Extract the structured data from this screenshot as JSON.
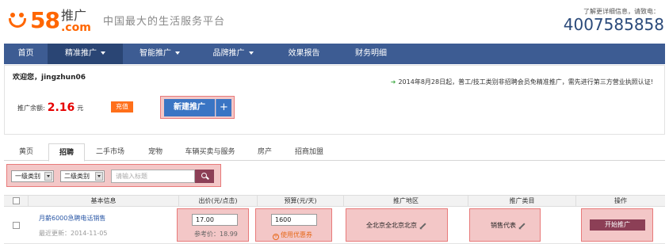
{
  "header": {
    "logo_number": "58",
    "logo_tg": "推广",
    "logo_com": ".com",
    "slogan": "中国最大的生活服务平台",
    "hotline_label": "了解更详细信息，请致电：",
    "hotline": "4007585858"
  },
  "nav": {
    "items": [
      {
        "label": "首页",
        "dropdown": false
      },
      {
        "label": "精准推广",
        "dropdown": true,
        "active": true
      },
      {
        "label": "智能推广",
        "dropdown": true
      },
      {
        "label": "品牌推广",
        "dropdown": true
      },
      {
        "label": "效果报告",
        "dropdown": false
      },
      {
        "label": "财务明细",
        "dropdown": false
      }
    ]
  },
  "account": {
    "welcome": "欢迎您，jingzhun06",
    "notice": "2014年8月28日起，普工/技工类别非招聘会员免精准推广，需先进行第三方营业执照认证!",
    "balance_label": "推广余额:",
    "balance": "2.16",
    "balance_unit": "元",
    "recharge_label": "充值",
    "new_promo_label": "新建推广",
    "plus_label": "+"
  },
  "tabs": [
    "黄页",
    "招聘",
    "二手市场",
    "宠物",
    "车辆买卖与服务",
    "房产",
    "招商加盟"
  ],
  "active_tab": "招聘",
  "filter": {
    "category1": "一级类别",
    "category2": "二级类别",
    "title_placeholder": "请输入标题"
  },
  "table": {
    "headers": [
      "基本信息",
      "出价(元/点击)",
      "预算(元/天)",
      "推广地区",
      "推广类目",
      "操作"
    ],
    "rows": [
      {
        "title": "月薪6000急聘电话销售",
        "updated": "最近更新：2014-11-05",
        "bid": "17.00",
        "reference_price": "参考价：18.99",
        "budget": "1600",
        "coupon_label": "使用优惠券",
        "region": "全北京全北京北京",
        "category": "销售代表",
        "action": "开始推广"
      }
    ]
  },
  "colors": {
    "brand_orange": "#ff6600",
    "nav_blue": "#3d5c93",
    "button_blue": "#3a75c4",
    "highlight_pink": "#f3c7c7",
    "action_maroon": "#8c3f56"
  }
}
